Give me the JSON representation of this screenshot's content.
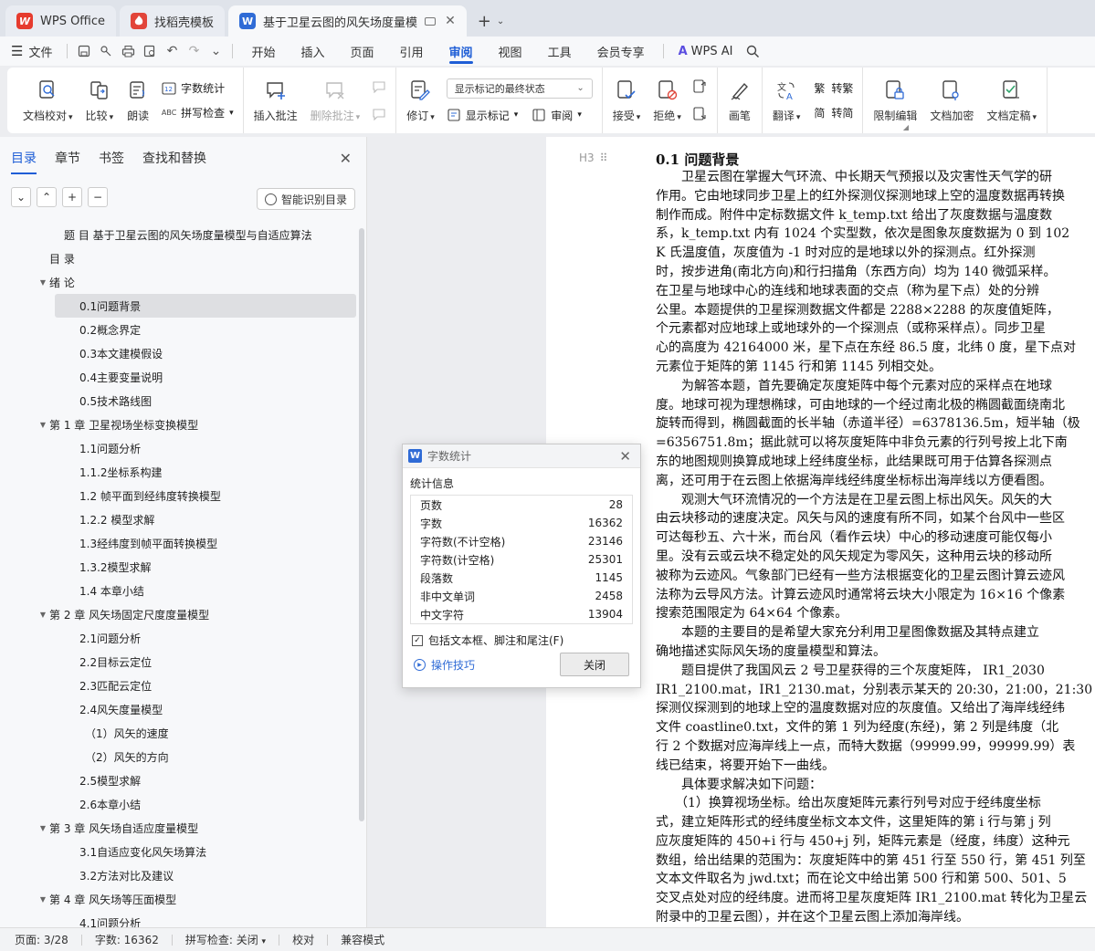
{
  "tabs": [
    {
      "label": "WPS Office",
      "icon": "wps-logo-icon"
    },
    {
      "label": "找稻壳模板",
      "icon": "daoke-logo-icon"
    },
    {
      "label": "基于卫星云图的风矢场度量模",
      "icon": "writer-logo-icon"
    }
  ],
  "menu": {
    "file": "文件",
    "tabs": [
      "开始",
      "插入",
      "页面",
      "引用",
      "审阅",
      "视图",
      "工具",
      "会员专享"
    ],
    "active_tab": "审阅",
    "wps_ai": "WPS AI"
  },
  "ribbon": {
    "doc_check": "文档校对",
    "compare": "比较",
    "read_aloud": "朗读",
    "word_count": "字数统计",
    "spell_check": "拼写检查",
    "insert_comment": "插入批注",
    "delete_comment": "删除批注",
    "revise": "修订",
    "markup_select": "显示标记的最终状态",
    "show_markup": "显示标记",
    "review": "审阅",
    "accept": "接受",
    "reject": "拒绝",
    "pen": "画笔",
    "translate": "翻译",
    "trad": "繁",
    "to_trad": "转繁",
    "simp": "简",
    "to_simp": "转简",
    "restrict_edit": "限制编辑",
    "doc_encrypt": "文档加密",
    "doc_finalize": "文档定稿"
  },
  "nav": {
    "tabs": [
      "目录",
      "章节",
      "书签",
      "查找和替换"
    ],
    "smart_toc": "智能识别目录",
    "toc": [
      {
        "text": "题 目 基于卫星云图的风矢场度量模型与自适应算法",
        "level": "l0"
      },
      {
        "text": "目 录",
        "level": "l1b"
      },
      {
        "text": "绪 论",
        "level": "l1",
        "expand": true
      },
      {
        "text": "0.1问题背景",
        "level": "l2",
        "selected": true
      },
      {
        "text": "0.2概念界定",
        "level": "l2"
      },
      {
        "text": "0.3本文建模假设",
        "level": "l2"
      },
      {
        "text": "0.4主要变量说明",
        "level": "l2"
      },
      {
        "text": "0.5技术路线图",
        "level": "l2"
      },
      {
        "text": "第 1 章 卫星视场坐标变换模型",
        "level": "l1",
        "expand": true
      },
      {
        "text": "1.1问题分析",
        "level": "l2"
      },
      {
        "text": "1.1.2坐标系构建",
        "level": "l2"
      },
      {
        "text": "1.2 帧平面到经纬度转换模型",
        "level": "l2"
      },
      {
        "text": "1.2.2 模型求解",
        "level": "l2"
      },
      {
        "text": "1.3经纬度到帧平面转换模型",
        "level": "l2"
      },
      {
        "text": "1.3.2模型求解",
        "level": "l2"
      },
      {
        "text": "1.4 本章小结",
        "level": "l2"
      },
      {
        "text": "第 2 章 风矢场固定尺度度量模型",
        "level": "l1",
        "expand": true
      },
      {
        "text": "2.1问题分析",
        "level": "l2"
      },
      {
        "text": "2.2目标云定位",
        "level": "l2"
      },
      {
        "text": "2.3匹配云定位",
        "level": "l2"
      },
      {
        "text": "2.4风矢度量模型",
        "level": "l2"
      },
      {
        "text": "（1）风矢的速度",
        "level": "l3"
      },
      {
        "text": "（2）风矢的方向",
        "level": "l3"
      },
      {
        "text": "2.5模型求解",
        "level": "l2"
      },
      {
        "text": "2.6本章小结",
        "level": "l2"
      },
      {
        "text": "第 3 章 风矢场自适应度量模型",
        "level": "l1",
        "expand": true
      },
      {
        "text": "3.1自适应变化风矢场算法",
        "level": "l2"
      },
      {
        "text": "3.2方法对比及建议",
        "level": "l2"
      },
      {
        "text": "第 4 章 风矢场等压面模型",
        "level": "l1",
        "expand": true
      },
      {
        "text": "4.1问题分析",
        "level": "l2"
      }
    ]
  },
  "doc": {
    "heading_marker": "H3",
    "title": "0.1 问题背景",
    "lines": [
      "　　卫星云图在掌握大气环流、中长期天气预报以及灾害性天气学的研",
      "作用。它由地球同步卫星上的红外探测仪探测地球上空的温度数据再转换",
      "制作而成。附件中定标数据文件 k_temp.txt 给出了灰度数据与温度数",
      "系，k_temp.txt 内有 1024 个实型数，依次是图象灰度数据为 0 到 102",
      "K 氏温度值，灰度值为 -1 时对应的是地球以外的探测点。红外探测",
      "时，按步进角(南北方向)和行扫描角（东西方向）均为 140 微弧采样。",
      "在卫星与地球中心的连线和地球表面的交点（称为星下点）处的分辨",
      "公里。本题提供的卫星探测数据文件都是 2288×2288 的灰度值矩阵，",
      "个元素都对应地球上或地球外的一个探测点（或称采样点）。同步卫星",
      "心的高度为 42164000 米，星下点在东经 86.5 度，北纬 0 度，星下点对",
      "元素位于矩阵的第 1145 行和第 1145 列相交处。",
      "　　为解答本题，首先要确定灰度矩阵中每个元素对应的采样点在地球",
      "度。地球可视为理想椭球，可由地球的一个经过南北极的椭圆截面绕南北",
      "旋转而得到，椭圆截面的长半轴（赤道半径）=6378136.5m，短半轴（极",
      "=6356751.8m；据此就可以将灰度矩阵中非负元素的行列号按上北下南",
      "东的地图规则换算成地球上经纬度坐标，此结果既可用于估算各探测点",
      "离，还可用于在云图上依据海岸线经纬度坐标标出海岸线以方便看图。",
      "　　观测大气环流情况的一个方法是在卫星云图上标出风矢。风矢的大",
      "由云块移动的速度决定。风矢与风的速度有所不同，如某个台风中一些区",
      "可达每秒五、六十米，而台风（看作云块）中心的移动速度可能仅每小",
      "里。没有云或云块不稳定处的风矢规定为零风矢，这种用云块的移动所",
      "被称为云迹风。气象部门已经有一些方法根据变化的卫星云图计算云迹风",
      "法称为云导风方法。计算云迹风时通常将云块大小限定为 16×16 个像素",
      "搜索范围限定为 64×64 个像素。",
      "　　本题的主要目的是希望大家充分利用卫星图像数据及其特点建立",
      "确地描述实际风矢场的度量模型和算法。",
      "　　题目提供了我国风云 2 号卫星获得的三个灰度矩阵， IR1_2030",
      "IR1_2100.mat，IR1_2130.mat，分别表示某天的 20:30，21:00，21:30",
      "探测仪探测到的地球上空的温度数据对应的灰度值。又给出了海岸线经纬",
      "文件 coastline0.txt，文件的第 1 列为经度(东经)，第 2 列是纬度（北",
      "行 2 个数据对应海岸线上一点，而特大数据（99999.99，99999.99）表",
      "线已结束，将要开始下一曲线。",
      "　　具体要求解决如下问题：",
      "　　（1）换算视场坐标。给出灰度矩阵元素行列号对应于经纬度坐标",
      "式，建立矩阵形式的经纬度坐标文本文件，这里矩阵的第 i 行与第 j 列",
      "应灰度矩阵的 450+i 行与 450+j 列，矩阵元素是（经度，纬度）这种元",
      "数组，给出结果的范围为：灰度矩阵中的第 451 行至 550 行，第 451 列至",
      "文本文件取名为 jwd.txt；而在论文中给出第 500 行和第 500、501、5",
      "交叉点处对应的经纬度。进而将卫星灰度矩阵 IR1_2100.mat 转化为卫星云",
      "附录中的卫星云图），并在这个卫星云图上添加海岸线。"
    ]
  },
  "word_count_dialog": {
    "title": "字数统计",
    "section": "统计信息",
    "rows": [
      {
        "label": "页数",
        "value": "28"
      },
      {
        "label": "字数",
        "value": "16362"
      },
      {
        "label": "字符数(不计空格)",
        "value": "23146"
      },
      {
        "label": "字符数(计空格)",
        "value": "25301"
      },
      {
        "label": "段落数",
        "value": "1145"
      },
      {
        "label": "非中文单词",
        "value": "2458"
      },
      {
        "label": "中文字符",
        "value": "13904"
      }
    ],
    "include_label": "包括文本框、脚注和尾注(F)",
    "include_checked": true,
    "tips": "操作技巧",
    "close": "关闭"
  },
  "status": {
    "page": "页面: 3/28",
    "words": "字数: 16362",
    "spell": "拼写检查: 关闭",
    "proof": "校对",
    "compat": "兼容模式"
  }
}
